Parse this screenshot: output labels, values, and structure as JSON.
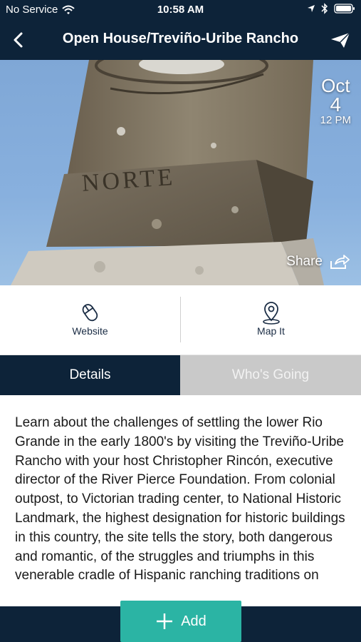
{
  "status_bar": {
    "carrier": "No Service",
    "time": "10:58 AM",
    "icons": [
      "wifi-icon",
      "location-arrow-icon",
      "bluetooth-icon",
      "battery-icon"
    ]
  },
  "nav": {
    "title": "Open House/Treviño-Uribe Rancho",
    "icons": [
      "back-chevron-icon",
      "paper-plane-icon"
    ]
  },
  "hero": {
    "carved_text": "NORTE",
    "date": {
      "month": "Oct",
      "day": "4",
      "time": "12 PM"
    },
    "share_label": "Share",
    "share_icon": "share-icon"
  },
  "actions": [
    {
      "label": "Website",
      "icon": "mouse-icon"
    },
    {
      "label": "Map It",
      "icon": "map-pin-icon"
    }
  ],
  "tabs": [
    {
      "label": "Details",
      "active": true
    },
    {
      "label": "Who's Going",
      "active": false
    }
  ],
  "description": "Learn about the challenges of settling the lower Rio Grande in the early 1800's by visiting the Treviño-Uribe Rancho with your host Christopher Rincón, executive director of the River Pierce Foundation. From colonial outpost, to Victorian trading center, to National Historic Landmark, the highest designation for historic buildings in this country, the site tells the story, both dangerous and romantic, of the struggles and triumphs in this venerable cradle of Hispanic ranching traditions on",
  "bottom": {
    "add_label": "Add",
    "add_icon": "plus-icon"
  },
  "colors": {
    "navy": "#0d2339",
    "teal": "#2bb4a4",
    "tab_inactive": "#c9c9c9"
  }
}
